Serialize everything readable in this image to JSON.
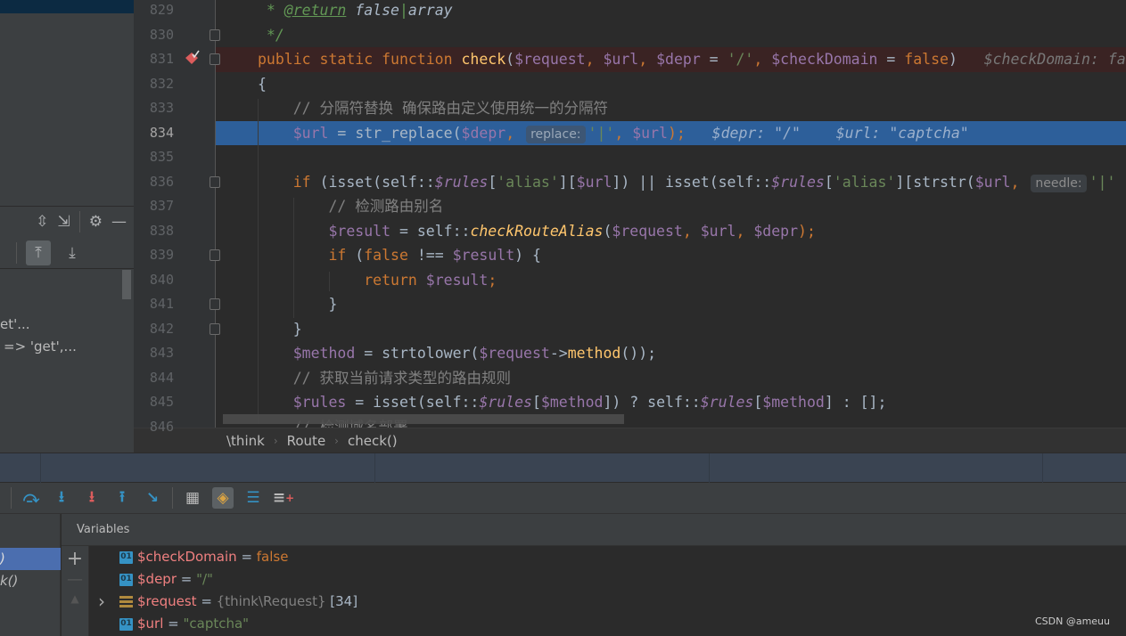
{
  "left_panel": {
    "text_1": "et'...",
    "text_2": "=> 'get',..."
  },
  "editor": {
    "lines": [
      {
        "n": "829",
        "tokens": [
          [
            " * ",
            "doc"
          ],
          [
            "@return",
            "doctag"
          ],
          [
            " false",
            "doct"
          ],
          [
            "|",
            "doc"
          ],
          [
            "array",
            "doct"
          ]
        ]
      },
      {
        "n": "830",
        "tokens": [
          [
            " */",
            "doc"
          ]
        ]
      },
      {
        "n": "831",
        "tokens": [
          [
            "public static function ",
            "k"
          ],
          [
            "check",
            "f"
          ],
          [
            "(",
            "d"
          ],
          [
            "$request",
            "v"
          ],
          [
            ", ",
            "k"
          ],
          [
            "$url",
            "v"
          ],
          [
            ", ",
            "k"
          ],
          [
            "$depr",
            "v"
          ],
          [
            " = ",
            "d"
          ],
          [
            "'/'",
            "s"
          ],
          [
            ", ",
            "k"
          ],
          [
            "$checkDomain",
            "v"
          ],
          [
            " = ",
            "d"
          ],
          [
            "false",
            "k"
          ],
          [
            ")",
            "d"
          ],
          [
            "   $checkDomain: false",
            "dbg"
          ]
        ]
      },
      {
        "n": "832",
        "tokens": [
          [
            "{",
            "d"
          ]
        ]
      },
      {
        "n": "833",
        "tokens": [
          [
            "    // 分隔符替换 确保路由定义使用统一的分隔符",
            "c"
          ]
        ]
      },
      {
        "n": "834",
        "tokens": [
          [
            "    ",
            "d"
          ],
          [
            "$url",
            "v"
          ],
          [
            " = ",
            "d"
          ],
          [
            "str_replace",
            "d"
          ],
          [
            "(",
            "d"
          ],
          [
            "$depr",
            "v"
          ],
          [
            ", ",
            "k"
          ],
          [
            "replace:",
            "h"
          ],
          [
            "'|'",
            "s"
          ],
          [
            ", ",
            "k"
          ],
          [
            "$url",
            "v"
          ],
          [
            ");",
            "k"
          ],
          [
            "   $depr: \"/\"    $url: \"captcha\"",
            "dbg"
          ]
        ]
      },
      {
        "n": "835",
        "tokens": []
      },
      {
        "n": "836",
        "tokens": [
          [
            "    ",
            "d"
          ],
          [
            "if ",
            "k"
          ],
          [
            "(isset(self::",
            "d"
          ],
          [
            "$rules",
            "vi"
          ],
          [
            "[",
            "d"
          ],
          [
            "'alias'",
            "s"
          ],
          [
            "][",
            "d"
          ],
          [
            "$url",
            "v"
          ],
          [
            "]) || isset(self::",
            "d"
          ],
          [
            "$rules",
            "vi"
          ],
          [
            "[",
            "d"
          ],
          [
            "'alias'",
            "s"
          ],
          [
            "][strstr(",
            "d"
          ],
          [
            "$url",
            "v"
          ],
          [
            ", ",
            "k"
          ],
          [
            "needle:",
            "h"
          ],
          [
            "'|'",
            "s"
          ]
        ]
      },
      {
        "n": "837",
        "tokens": [
          [
            "        // 检测路由别名",
            "c"
          ]
        ]
      },
      {
        "n": "838",
        "tokens": [
          [
            "        ",
            "d"
          ],
          [
            "$result",
            "v"
          ],
          [
            " = self::",
            "d"
          ],
          [
            "checkRouteAlias",
            "fi"
          ],
          [
            "(",
            "d"
          ],
          [
            "$request",
            "v"
          ],
          [
            ", ",
            "k"
          ],
          [
            "$url",
            "v"
          ],
          [
            ", ",
            "k"
          ],
          [
            "$depr",
            "v"
          ],
          [
            ");",
            "k"
          ]
        ]
      },
      {
        "n": "839",
        "tokens": [
          [
            "        ",
            "d"
          ],
          [
            "if ",
            "k"
          ],
          [
            "(",
            "d"
          ],
          [
            "false ",
            "k"
          ],
          [
            "!== ",
            "d"
          ],
          [
            "$result",
            "v"
          ],
          [
            ") {",
            "d"
          ]
        ]
      },
      {
        "n": "840",
        "tokens": [
          [
            "            ",
            "d"
          ],
          [
            "return ",
            "k"
          ],
          [
            "$result",
            "v"
          ],
          [
            ";",
            "k"
          ]
        ]
      },
      {
        "n": "841",
        "tokens": [
          [
            "        }",
            "d"
          ]
        ]
      },
      {
        "n": "842",
        "tokens": [
          [
            "    }",
            "d"
          ]
        ]
      },
      {
        "n": "843",
        "tokens": [
          [
            "    ",
            "d"
          ],
          [
            "$method",
            "v"
          ],
          [
            " = strtolower(",
            "d"
          ],
          [
            "$request",
            "v"
          ],
          [
            "->",
            "d"
          ],
          [
            "method",
            "f"
          ],
          [
            "());",
            "d"
          ]
        ]
      },
      {
        "n": "844",
        "tokens": [
          [
            "    // 获取当前请求类型的路由规则",
            "c"
          ]
        ]
      },
      {
        "n": "845",
        "tokens": [
          [
            "    ",
            "d"
          ],
          [
            "$rules",
            "v"
          ],
          [
            " = isset(self::",
            "d"
          ],
          [
            "$rules",
            "vi"
          ],
          [
            "[",
            "d"
          ],
          [
            "$method",
            "v"
          ],
          [
            "]) ? self::",
            "d"
          ],
          [
            "$rules",
            "vi"
          ],
          [
            "[",
            "d"
          ],
          [
            "$method",
            "v"
          ],
          [
            "] : [];",
            "d"
          ]
        ]
      },
      {
        "n": "846",
        "tokens": [
          [
            "    // 检测域名部署",
            "c"
          ]
        ]
      }
    ],
    "current_line": "834",
    "breakpoint_line": "831"
  },
  "breadcrumb": [
    "\\think",
    "Route",
    "check()"
  ],
  "debugger": {
    "frames": {
      "selected": ")",
      "second": "k()"
    },
    "variables_title": "Variables",
    "variables": [
      {
        "name": "$checkDomain",
        "eq": " = ",
        "value": "false",
        "type": "bool",
        "icon": "primitive-icon"
      },
      {
        "name": "$depr",
        "eq": " = ",
        "value": "\"/\"",
        "type": "string",
        "icon": "primitive-icon"
      },
      {
        "name": "$request",
        "eq": " = ",
        "value": "{think\\Request}",
        "extra": " [34]",
        "type": "object",
        "icon": "object-icon"
      },
      {
        "name": "$url",
        "eq": " = ",
        "value": "\"captcha\"",
        "type": "string",
        "icon": "primitive-icon"
      }
    ],
    "badge_text": "01"
  },
  "watermark": "CSDN @ameuu",
  "colors": {
    "accent_exec": "#2d5f9a",
    "breakpoint": "#db5c5c",
    "keyword": "#cc7832",
    "variable": "#9876aa",
    "string": "#6a8759"
  }
}
